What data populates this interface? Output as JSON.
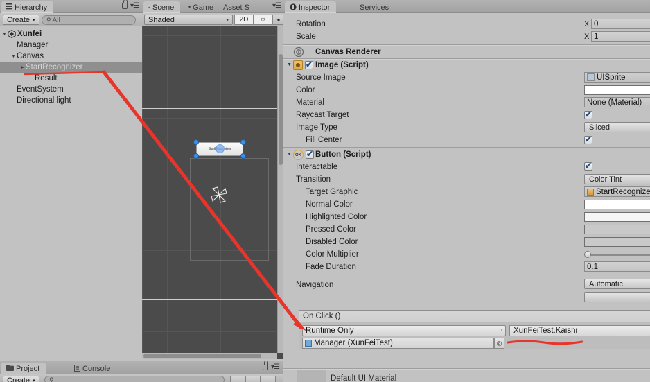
{
  "window": {
    "background": "#a5a5a5",
    "accent_red": "#e8352b"
  },
  "hierarchy": {
    "tab_label": "Hierarchy",
    "tab_icon": "hierarchy-icon",
    "create_label": "Create",
    "create_caret": "▾",
    "search_placeholder": "All",
    "search_icon": "search-icon",
    "lock_icon": "lock-icon",
    "menu_icon": "hamburger-menu-icon",
    "items": [
      {
        "label": "Xunfei",
        "depth": 0,
        "foldout": "open",
        "icon": "unity-scene-icon",
        "selected": false,
        "root": true
      },
      {
        "label": "Manager",
        "depth": 1,
        "foldout": "none",
        "icon": "",
        "selected": false,
        "root": false
      },
      {
        "label": "Canvas",
        "depth": 1,
        "foldout": "open",
        "icon": "",
        "selected": false,
        "root": false
      },
      {
        "label": "StartRecognizer",
        "depth": 2,
        "foldout": "closed",
        "icon": "",
        "selected": true,
        "root": false
      },
      {
        "label": "Result",
        "depth": 3,
        "foldout": "none",
        "icon": "",
        "selected": false,
        "root": false
      },
      {
        "label": "EventSystem",
        "depth": 1,
        "foldout": "none",
        "icon": "",
        "selected": false,
        "root": false
      },
      {
        "label": "Directional light",
        "depth": 1,
        "foldout": "none",
        "icon": "",
        "selected": false,
        "root": false
      }
    ]
  },
  "scene": {
    "tabs": [
      {
        "label": "Scene",
        "active": true,
        "icon": "scene-icon"
      },
      {
        "label": "Game",
        "active": false,
        "icon": "game-icon"
      },
      {
        "label": "Asset S",
        "active": false,
        "icon": ""
      }
    ],
    "menu_icon": "hamburger-menu-icon",
    "draw_mode": "Shaded",
    "draw_mode_caret": "▾",
    "mode_2d": "2D",
    "light_icon": "sun-icon",
    "audio_icon": "speaker-icon",
    "selected_object_label": "StartRecognizer",
    "gizmo_icon": "move-gizmo-icon"
  },
  "inspector": {
    "tabs": [
      {
        "label": "Inspector",
        "active": true,
        "icon": "info-icon"
      },
      {
        "label": "Services",
        "active": false,
        "icon": ""
      }
    ],
    "transform": [
      {
        "label": "Rotation",
        "axis": "X",
        "value": "0"
      },
      {
        "label": "Scale",
        "axis": "X",
        "value": "1"
      }
    ],
    "canvas_renderer": {
      "title": "Canvas Renderer",
      "icon": "canvas-renderer-icon"
    },
    "image_component": {
      "title": "Image (Script)",
      "icon": "image-script-icon",
      "enabled": true,
      "foldout": "open",
      "rows": [
        {
          "label": "Source Image",
          "type": "object",
          "value": "UISprite",
          "icon": "sprite-icon",
          "indent": 0
        },
        {
          "label": "Color",
          "type": "color",
          "value": "#ffffff",
          "indent": 0
        },
        {
          "label": "Material",
          "type": "object",
          "value": "None (Material)",
          "indent": 0
        },
        {
          "label": "Raycast Target",
          "type": "checkbox",
          "checked": true,
          "indent": 0
        },
        {
          "label": "Image Type",
          "type": "popup",
          "value": "Sliced",
          "indent": 0
        },
        {
          "label": "Fill Center",
          "type": "checkbox",
          "checked": true,
          "indent": 1
        }
      ]
    },
    "button_component": {
      "title": "Button (Script)",
      "icon": "button-script-icon",
      "enabled": true,
      "foldout": "open",
      "rows": [
        {
          "label": "Interactable",
          "type": "checkbox",
          "checked": true,
          "indent": 0
        },
        {
          "label": "Transition",
          "type": "popup",
          "value": "Color Tint",
          "indent": 0
        },
        {
          "label": "Target Graphic",
          "type": "object",
          "value": "StartRecognize",
          "icon": "image-script-icon",
          "indent": 1
        },
        {
          "label": "Normal Color",
          "type": "color",
          "value": "#ffffff",
          "indent": 1
        },
        {
          "label": "Highlighted Color",
          "type": "color",
          "value": "#f5f5f5",
          "indent": 1
        },
        {
          "label": "Pressed Color",
          "type": "color",
          "value": "#c8c8c8",
          "indent": 1
        },
        {
          "label": "Disabled Color",
          "type": "color",
          "value": "#c8c8c8",
          "indent": 1
        },
        {
          "label": "Color Multiplier",
          "type": "slider",
          "value": 0,
          "indent": 1
        },
        {
          "label": "Fade Duration",
          "type": "text",
          "value": "0.1",
          "indent": 1
        },
        {
          "label": "Navigation",
          "type": "popup",
          "value": "Automatic",
          "indent": 0
        },
        {
          "label": "",
          "type": "button",
          "value": "",
          "indent": 0
        }
      ]
    },
    "on_click": {
      "title": "On Click ()",
      "mode": "Runtime Only",
      "mode_arrows": "⇕",
      "target_object": "Manager (XunFeiTest)",
      "target_icon": "script-icon",
      "picker_icon": "target-picker-icon",
      "function": "XunFeiTest.Kaishi"
    },
    "footer_text": "Default UI Material"
  },
  "bottom": {
    "tabs": [
      {
        "label": "Project",
        "active": true,
        "icon": "folder-icon"
      },
      {
        "label": "Console",
        "active": false,
        "icon": "console-icon"
      }
    ],
    "lock_icon": "lock-icon",
    "menu_icon": "hamburger-menu-icon",
    "create_label": "Create",
    "search_icon": "search-icon"
  },
  "annotations": {
    "underline_hierarchy": "red-underline-startrecognizer",
    "arrow": "red-arrow-to-runtime-only",
    "underline_onclick": "red-underline-manager-field"
  }
}
